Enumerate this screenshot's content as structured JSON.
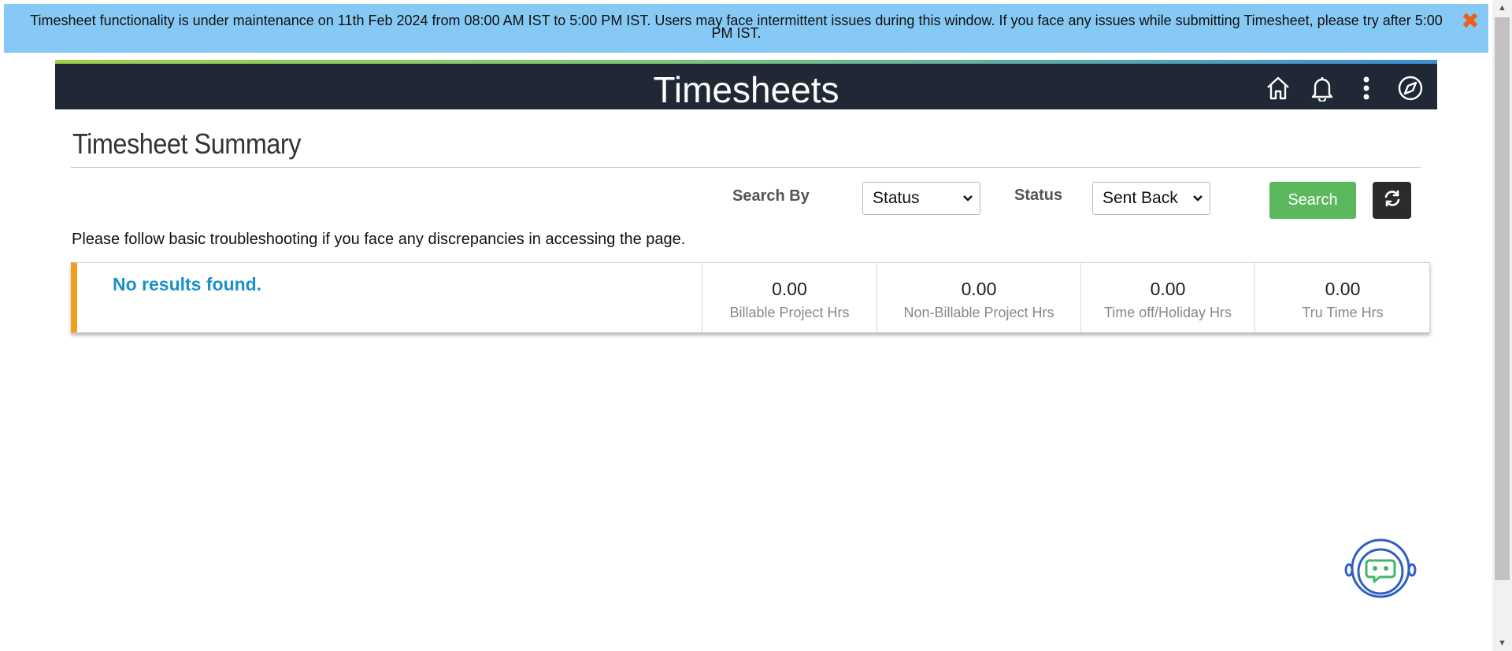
{
  "banner": {
    "message": "Timesheet functionality is under maintenance on 11th Feb 2024 from 08:00 AM IST to 5:00 PM IST. Users may face intermittent issues during this window. If you face any issues while submitting Timesheet, please try after 5:00 PM IST.",
    "close_icon": "close-icon",
    "close_color": "#e8611a"
  },
  "header": {
    "title": "Timesheets",
    "icons": [
      "home-icon",
      "bell-icon",
      "more-vertical-icon",
      "compass-icon"
    ],
    "background": "#1f2834"
  },
  "page": {
    "title": "Timesheet Summary",
    "note": "Please follow basic troubleshooting if you face any discrepancies in accessing the page."
  },
  "filters": {
    "search_by_label": "Search By",
    "search_by_value": "Status",
    "status_label": "Status",
    "status_value": "Sent Back",
    "search_button": "Search",
    "search_button_color": "#5cb85c",
    "refresh_icon": "refresh-icon"
  },
  "results": {
    "empty_message": "No results found.",
    "accent_color": "#f0a020",
    "metrics": [
      {
        "value": "0.00",
        "label": "Billable Project Hrs"
      },
      {
        "value": "0.00",
        "label": "Non-Billable Project Hrs"
      },
      {
        "value": "0.00",
        "label": "Time off/Holiday Hrs"
      },
      {
        "value": "0.00",
        "label": "Tru Time Hrs"
      }
    ]
  },
  "chatbot": {
    "icon": "chatbot-icon"
  }
}
